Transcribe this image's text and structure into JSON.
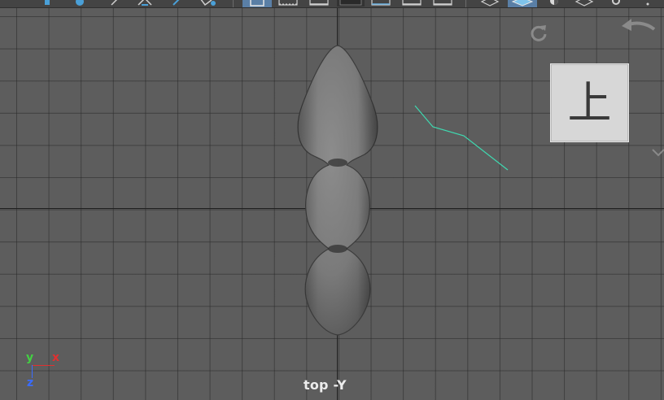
{
  "viewport": {
    "camera_label": "top -Y",
    "background_color": "#5d5d5d",
    "grid_color": "#3f3f3f",
    "axis_line_color": "#202020"
  },
  "viewcube": {
    "face_label": "上"
  },
  "axis_gizmo": {
    "y_label": "y",
    "x_label": "x",
    "z_label": "z",
    "y_color": "#43d043",
    "x_color": "#e03030",
    "z_color": "#3a6cff"
  },
  "curve": {
    "color": "#3fd9b0"
  },
  "toolbar": {
    "icons": [
      "move-tool-icon",
      "rotate-tool-icon",
      "scale-tool-icon",
      "lasso-icon",
      "soft-select-icon",
      "single-view-icon",
      "film-gate-icon",
      "resolution-gate-icon",
      "gate-mask-icon",
      "field-chart-icon",
      "safe-action-icon",
      "safe-title-icon",
      "wireframe-icon",
      "smooth-shade-icon",
      "lighting-icon",
      "isolate-icon",
      "settings-icon"
    ],
    "active_icon": "single-view-icon"
  }
}
